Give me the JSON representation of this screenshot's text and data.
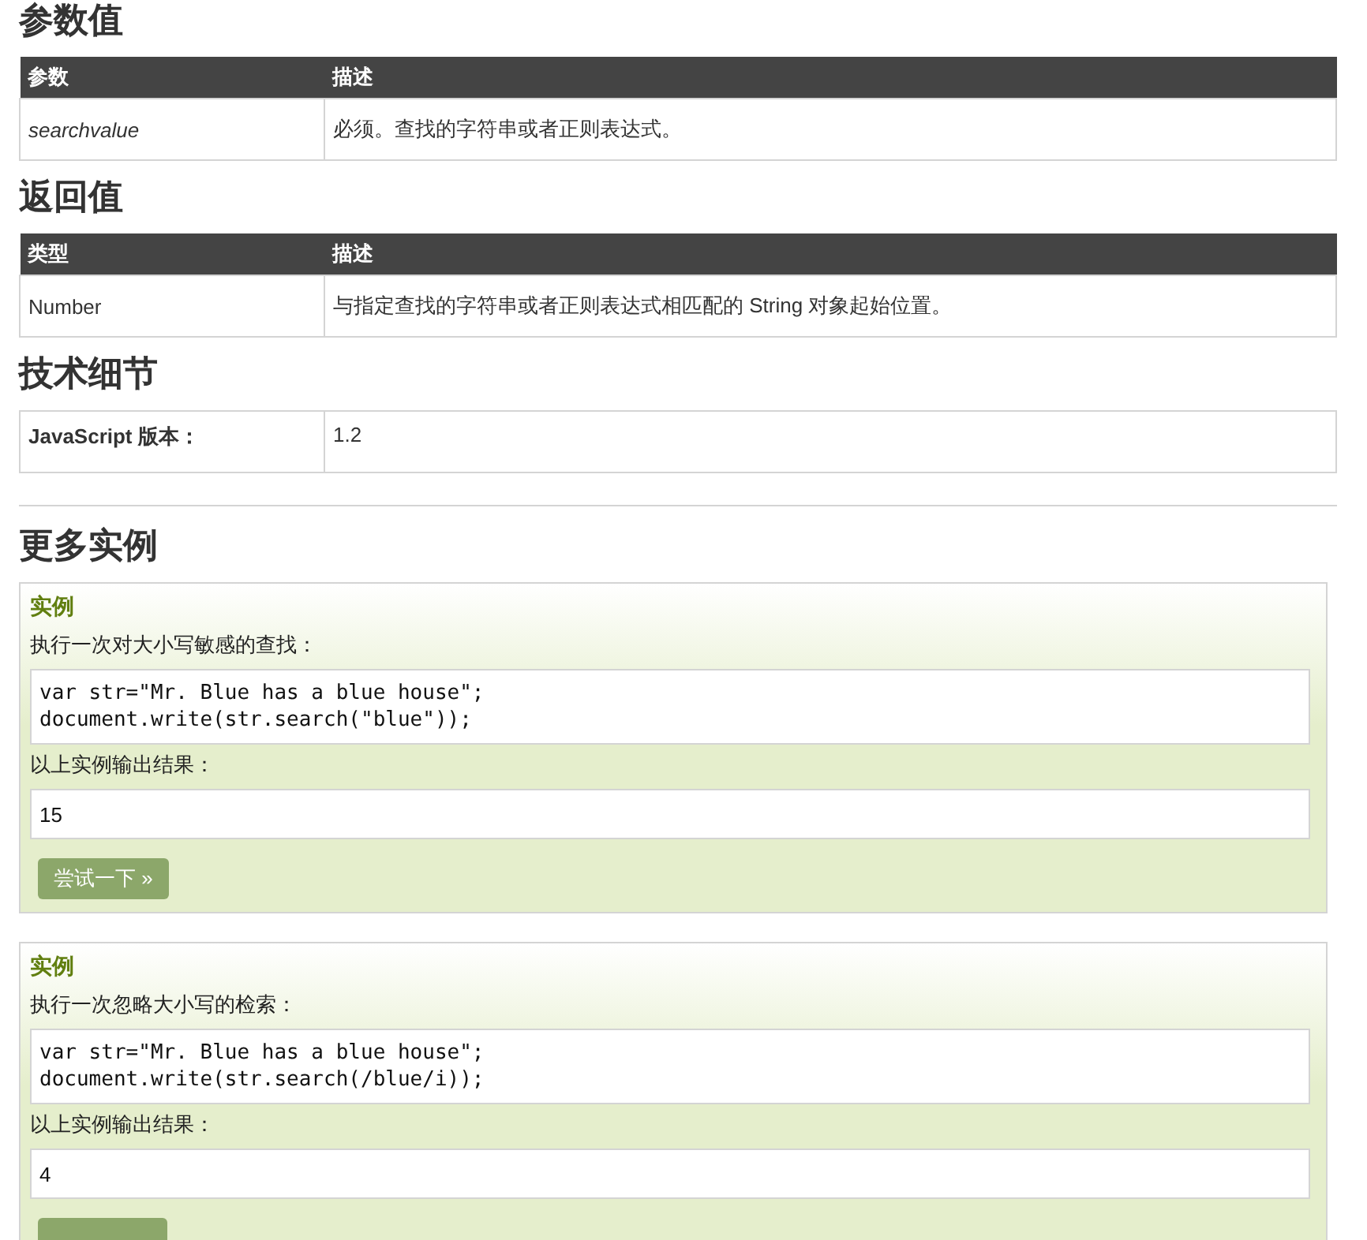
{
  "sections": [
    {
      "kind": "table",
      "heading": "参数值",
      "columns": [
        "参数",
        "描述"
      ],
      "first_italic": true,
      "first_bold": false,
      "rows": [
        [
          "searchvalue",
          "必须。查找的字符串或者正则表达式。"
        ]
      ]
    },
    {
      "kind": "table",
      "heading": "返回值",
      "columns": [
        "类型",
        "描述"
      ],
      "first_italic": false,
      "first_bold": false,
      "rows": [
        [
          "Number",
          "与指定查找的字符串或者正则表达式相匹配的 String 对象起始位置。"
        ]
      ]
    },
    {
      "kind": "table",
      "heading": "技术细节",
      "first_italic": false,
      "first_bold": true,
      "rows": [
        [
          "JavaScript 版本：",
          "1.2"
        ]
      ]
    },
    {
      "kind": "divider"
    },
    {
      "kind": "examples",
      "heading": "更多实例",
      "examples": [
        {
          "title": "实例",
          "description": "执行一次对大小写敏感的查找：",
          "code": [
            "var str=\"Mr. Blue has a blue house\";",
            "document.write(str.search(\"blue\"));"
          ],
          "output_label": "以上实例输出结果：",
          "output": "15",
          "button": {
            "kind": "labeled",
            "label": "尝试一下 »"
          }
        },
        {
          "title": "实例",
          "description": "执行一次忽略大小写的检索：",
          "code": [
            "var str=\"Mr. Blue has a blue house\";",
            "document.write(str.search(/blue/i));"
          ],
          "output_label": "以上实例输出结果：",
          "output": "4",
          "button": {
            "kind": "cut"
          }
        }
      ]
    }
  ]
}
